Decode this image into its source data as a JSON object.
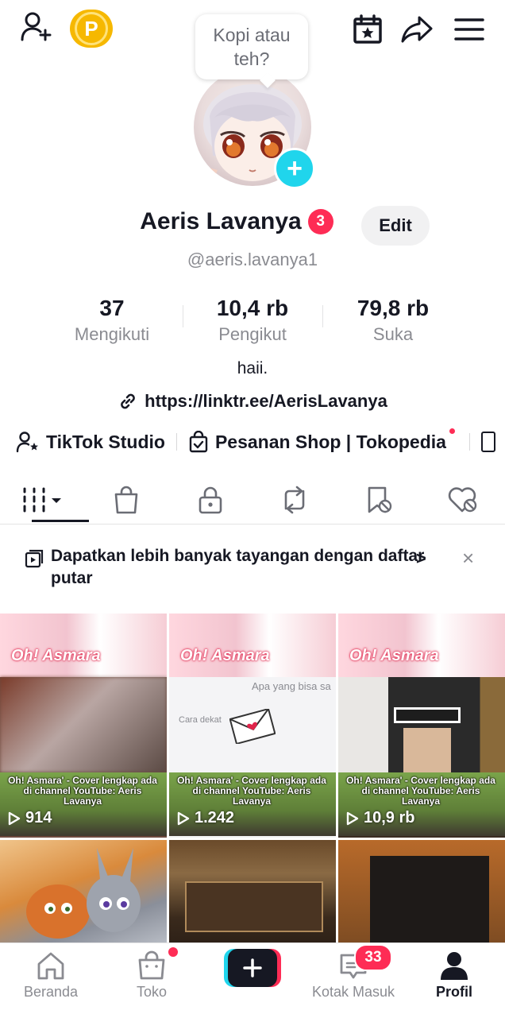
{
  "top_bar": {
    "add_friend_icon": "person-add-icon",
    "points_badge": "P",
    "calendar_icon": "calendar-star-icon",
    "share_icon": "share-arrow-icon",
    "menu_icon": "hamburger-menu-icon"
  },
  "note_bubble": {
    "text": "Kopi atau teh?"
  },
  "profile": {
    "name": "Aeris Lavanya",
    "name_badge_count": "3",
    "edit_label": "Edit",
    "handle": "@aeris.lavanya1",
    "stats": [
      {
        "value": "37",
        "label": "Mengikuti"
      },
      {
        "value": "10,4 rb",
        "label": "Pengikut"
      },
      {
        "value": "79,8 rb",
        "label": "Suka"
      }
    ],
    "bio": "haii.",
    "link": "https://linktr.ee/AerisLavanya"
  },
  "shortcuts": [
    {
      "label": "TikTok Studio",
      "icon": "person-star-icon"
    },
    {
      "label": "Pesanan Shop | Tokopedia",
      "icon": "bag-check-icon"
    }
  ],
  "tabs": [
    {
      "name": "videos",
      "icon": "grid-bars-icon",
      "active": true
    },
    {
      "name": "shop",
      "icon": "shopping-bag-icon"
    },
    {
      "name": "private",
      "icon": "lock-icon"
    },
    {
      "name": "reposts",
      "icon": "repost-icon"
    },
    {
      "name": "favorites",
      "icon": "bookmark-hidden-icon"
    },
    {
      "name": "liked",
      "icon": "heart-hidden-icon"
    }
  ],
  "playlist_banner": {
    "text": "Dapatkan lebih banyak tayangan dengan daftar putar",
    "chevron": ">",
    "close": "×"
  },
  "videos": [
    {
      "overlay_title": "Oh! Asmara",
      "caption": "Oh! Asmara' - Cover lengkap ada di channel YouTube: Aeris Lavanya",
      "views": "914"
    },
    {
      "overlay_title": "Oh! Asmara",
      "caption": "Oh! Asmara' - Cover lengkap ada di channel YouTube: Aeris Lavanya",
      "views": "1.242",
      "scene_text_1": "Apa yang bisa sa",
      "scene_text_2": "Cara dekat"
    },
    {
      "overlay_title": "Oh! Asmara",
      "caption": "Oh! Asmara' - Cover lengkap ada di channel YouTube: Aeris Lavanya",
      "views": "10,9 rb"
    }
  ],
  "bottom_nav": [
    {
      "label": "Beranda",
      "icon": "home-icon"
    },
    {
      "label": "Toko",
      "icon": "shop-bag-icon"
    },
    {
      "label": "",
      "icon": "plus-icon"
    },
    {
      "label": "Kotak Masuk",
      "icon": "inbox-icon",
      "badge": "33"
    },
    {
      "label": "Profil",
      "icon": "profile-icon",
      "active": true
    }
  ],
  "colors": {
    "accent_pink": "#fe2c55",
    "accent_cyan": "#20d5ec",
    "points_gold": "#f6b800",
    "text_primary": "#161823",
    "text_secondary": "#8a8b91"
  }
}
